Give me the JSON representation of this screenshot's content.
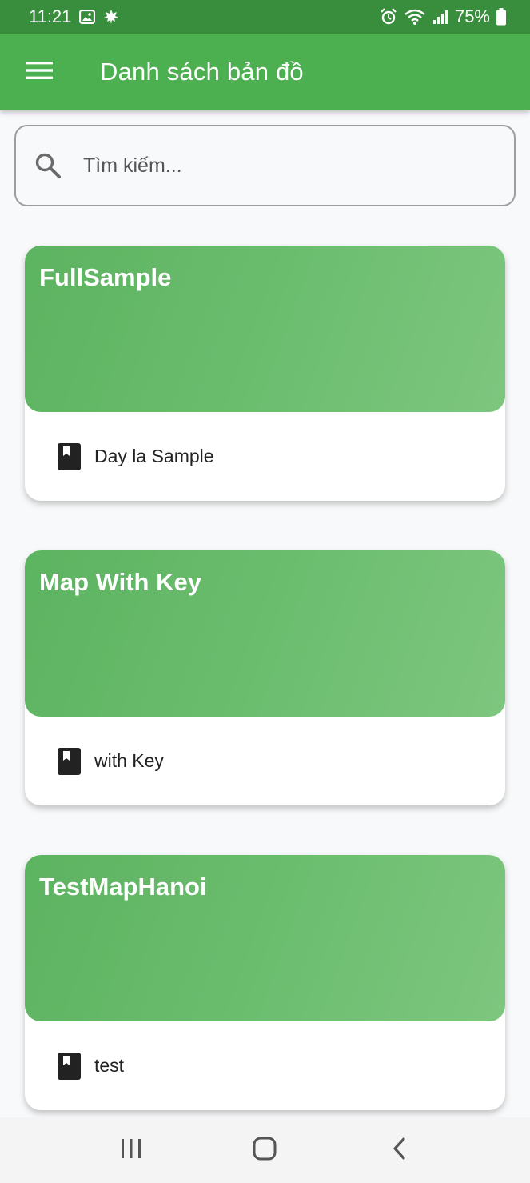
{
  "status_bar": {
    "time": "11:21",
    "battery": "75%",
    "icons": [
      "gallery-icon",
      "leaf-icon",
      "alarm-icon",
      "wifi-icon",
      "signal-icon",
      "battery-icon"
    ]
  },
  "app_bar": {
    "title": "Danh sách bản đồ",
    "menu_icon": "menu-icon"
  },
  "search": {
    "placeholder": "Tìm kiếm...",
    "value": "",
    "icon": "search-icon"
  },
  "maps": [
    {
      "title": "FullSample",
      "description": "Day la Sample",
      "icon": "book-icon"
    },
    {
      "title": "Map With Key",
      "description": "with Key",
      "icon": "book-icon"
    },
    {
      "title": "TestMapHanoi",
      "description": "test",
      "icon": "book-icon"
    }
  ],
  "nav_bar": {
    "buttons": [
      "recent-apps-icon",
      "home-icon",
      "back-icon"
    ]
  },
  "colors": {
    "status_bar": "#388e3c",
    "app_bar": "#4caf50",
    "card_gradient_start": "#5cb360",
    "card_gradient_end": "#7dc67f",
    "background": "#f8f9fa"
  }
}
